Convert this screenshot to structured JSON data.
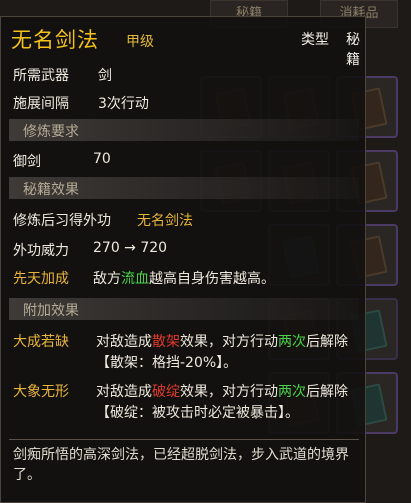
{
  "background": {
    "tabs": [
      "秘籍",
      "消耗品"
    ]
  },
  "tooltip": {
    "name": "无名剑法",
    "grade": "甲级",
    "type_label": "类型",
    "type_value": "秘籍",
    "stats": [
      {
        "label": "所需武器",
        "value": "剑"
      },
      {
        "label": "施展间隔",
        "value": "3次行动"
      }
    ],
    "section_cultivation": "修炼要求",
    "requirement": {
      "label": "御剑",
      "value": "70"
    },
    "section_effect": "秘籍效果",
    "learned": {
      "label": "修炼后习得外功",
      "value": "无名剑法"
    },
    "power": {
      "label": "外功威力",
      "value": "270 → 720"
    },
    "innate": {
      "label": "先天加成",
      "pre": "敌方",
      "highlight": "流血",
      "post": "越高自身伤害越高。"
    },
    "section_extra": "附加效果",
    "effects": [
      {
        "name": "大成若缺",
        "pre": "对敌造成",
        "status": "散架",
        "mid": "效果，对方行动",
        "count": "两次",
        "post": "后解除",
        "detail": "【散架：格挡-20%】。"
      },
      {
        "name": "大象无形",
        "pre": "对敌造成",
        "status": "破绽",
        "mid": "效果，对方行动",
        "count": "两次",
        "post": "后解除",
        "detail": "【破绽：被攻击时必定被暴击】。"
      }
    ],
    "description": "剑痴所悟的高深剑法，已经超脱剑法，步入武道的境界了。"
  }
}
